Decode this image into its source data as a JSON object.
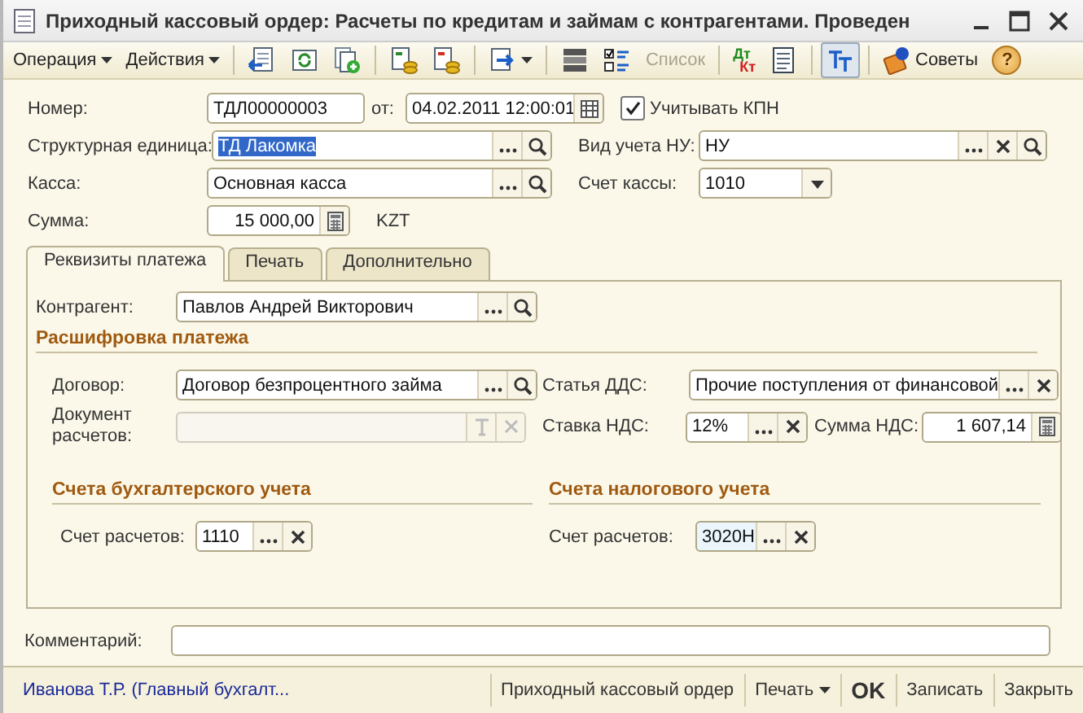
{
  "window": {
    "title": "Приходный кассовый ордер: Расчеты по кредитам и займам с контрагентами. Проведен"
  },
  "toolbar": [
    {
      "kind": "menu",
      "label": "Операция"
    },
    {
      "kind": "menu",
      "label": "Действия"
    },
    {
      "kind": "sep"
    },
    {
      "kind": "icon",
      "pressed": false
    },
    {
      "kind": "icon",
      "pressed": false
    },
    {
      "kind": "icon",
      "pressed": false
    },
    {
      "kind": "sep"
    },
    {
      "kind": "icon",
      "pressed": false
    },
    {
      "kind": "icon",
      "pressed": false
    },
    {
      "kind": "sep"
    },
    {
      "kind": "icon-menu",
      "pressed": false
    },
    {
      "kind": "sep"
    },
    {
      "kind": "icon",
      "pressed": false
    },
    {
      "kind": "icon",
      "pressed": false
    },
    {
      "kind": "text",
      "label": "Список",
      "disabled": true
    },
    {
      "kind": "sep"
    },
    {
      "kind": "dtkt",
      "label": "Дт",
      "sublabel": "Кт"
    },
    {
      "kind": "icon",
      "pressed": false
    },
    {
      "kind": "sep"
    },
    {
      "kind": "icon",
      "pressed": true
    },
    {
      "kind": "sep"
    },
    {
      "kind": "tips",
      "label": "Советы"
    },
    {
      "kind": "help",
      "label": "?"
    }
  ],
  "header": {
    "number": {
      "label": "Номер:",
      "value": "ТДЛ00000003"
    },
    "date": {
      "label": "от:",
      "value": "04.02.2011 12:00:01"
    },
    "kpn": {
      "label": "Учитывать КПН",
      "checked": true
    },
    "unit": {
      "label": "Структурная единица:",
      "value": "ТД Лакомка",
      "selected": true
    },
    "tax_kind": {
      "label": "Вид учета НУ:",
      "value": "НУ"
    },
    "cashbox": {
      "label": "Касса:",
      "value": "Основная касса"
    },
    "cash_account": {
      "label": "Счет кассы:",
      "value": "1010"
    },
    "amount": {
      "label": "Сумма:",
      "value": "15 000,00",
      "currency": "KZT"
    }
  },
  "tabs": [
    {
      "label": "Реквизиты платежа",
      "selected": true
    },
    {
      "label": "Печать",
      "selected": false
    },
    {
      "label": "Дополнительно",
      "selected": false
    }
  ],
  "payment": {
    "counterparty": {
      "label": "Контрагент:",
      "value": "Павлов Андрей Викторович"
    },
    "breakdown_title": "Расшифровка платежа",
    "contract": {
      "label": "Договор:",
      "value": "Договор безпроцентного займа"
    },
    "cash_flow_item": {
      "label": "Статья ДДС:",
      "value": "Прочие поступления от финансовой"
    },
    "settlement_document": {
      "label": "Документ расчетов:",
      "disabled": true
    },
    "vat_rate": {
      "label": "Ставка НДС:",
      "value": "12%"
    },
    "vat_amount": {
      "label": "Сумма НДС:",
      "value": "1 607,14"
    },
    "accounting": {
      "title": "Счета бухгалтерского учета",
      "account": {
        "label": "Счет расчетов:",
        "value": "1110",
        "focused": false
      }
    },
    "tax": {
      "title": "Счета налогового учета",
      "account": {
        "label": "Счет расчетов:",
        "value": "3020Н",
        "focused": true
      }
    }
  },
  "comment": {
    "label": "Комментарий:"
  },
  "status_bar": {
    "user": "Иванова Т.Р. (Главный бухгалт...",
    "buttons": [
      {
        "kind": "plain",
        "label": "Приходный кассовый ордер"
      },
      {
        "kind": "menu",
        "label": "Печать"
      },
      {
        "kind": "default",
        "label": "OK"
      },
      {
        "kind": "plain",
        "label": "Записать"
      },
      {
        "kind": "plain",
        "label": "Закрыть"
      }
    ]
  }
}
